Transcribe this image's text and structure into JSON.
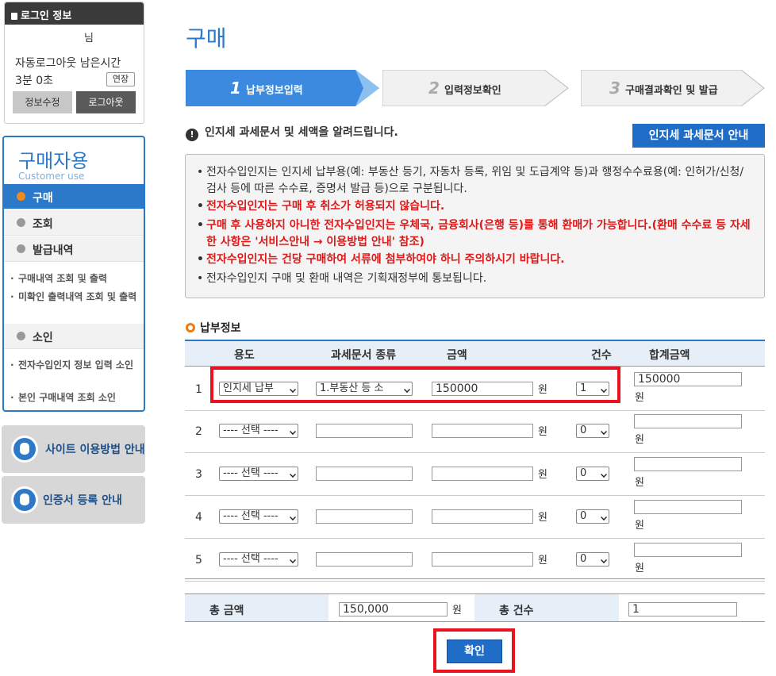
{
  "login": {
    "header": "로그인 정보",
    "user_suffix": "님",
    "auto_logout_label": "자동로그아웃 남은시간",
    "remaining_time": "3분 0초",
    "extend_label": "연장",
    "edit_info_label": "정보수정",
    "logout_label": "로그아웃"
  },
  "sidebar": {
    "title": "구매자용",
    "subtitle": "Customer use",
    "menu": {
      "purchase": "구매",
      "inquiry": "조회",
      "issue_history": "발급내역",
      "sub_history": "구매내역 조회 및 출력",
      "sub_unconfirmed": "미확인 출력내역 조회 및 출력",
      "lawsuit": "소인",
      "sub_stamp_info": "전자수입인지 정보 입력 소인",
      "sub_my_purchase": "본인 구매내역 조회 소인"
    },
    "site_guide": "사이트 이용방법 안내",
    "cert_guide": "인증서 등록 안내"
  },
  "page_title": "구매",
  "steps": [
    {
      "num": "1",
      "label": "납부정보입력",
      "active": true
    },
    {
      "num": "2",
      "label": "입력정보확인",
      "active": false
    },
    {
      "num": "3",
      "label": "구매결과확인 및 발급",
      "active": false
    }
  ],
  "notice": {
    "title": "인지세 과세문서 및 세액을 알려드립니다.",
    "guide_button": "인지세 과세문서 안내",
    "lines": [
      "전자수입인지는 인지세 납부용(예: 부동산 등기, 자동차 등록, 위임 및 도급계약 등)과 행정수수료용(예: 인허가/신청/검사 등에 따른 수수료, 증명서 발급 등)으로 구분됩니다.",
      "전자수입인지는 구매 후 취소가 허용되지 않습니다.",
      "구매 후 사용하지 아니한 전자수입인지는 우체국, 금융회사(은행 등)를 통해 환매가 가능합니다.(환매 수수료 등 자세한 사항은 '서비스안내 → 이용방법 안내' 참조)",
      "전자수입인지는 건당 구매하여 서류에 첨부하여야 하니 주의하시기 바랍니다.",
      "전자수입인지 구매 및 환매 내역은 기획재정부에 통보됩니다."
    ]
  },
  "payment": {
    "section_title": "납부정보",
    "columns": [
      "용도",
      "과세문서 종류",
      "금액",
      "건수",
      "합계금액"
    ],
    "won": "원",
    "rows": [
      {
        "idx": "1",
        "usage": "인지세 납부",
        "doc_type": "1.부동산 등 소",
        "amount": "150000",
        "count": "1",
        "total": "150000"
      },
      {
        "idx": "2",
        "usage": "---- 선택 ----",
        "doc_type": "",
        "amount": "",
        "count": "0",
        "total": ""
      },
      {
        "idx": "3",
        "usage": "---- 선택 ----",
        "doc_type": "",
        "amount": "",
        "count": "0",
        "total": ""
      },
      {
        "idx": "4",
        "usage": "---- 선택 ----",
        "doc_type": "",
        "amount": "",
        "count": "0",
        "total": ""
      },
      {
        "idx": "5",
        "usage": "---- 선택 ----",
        "doc_type": "",
        "amount": "",
        "count": "0",
        "total": ""
      }
    ]
  },
  "totals": {
    "amount_label": "총 금액",
    "amount_value": "150,000",
    "count_label": "총 건수",
    "count_value": "1"
  },
  "confirm_label": "확인",
  "colors": {
    "primary": "#2b79c8",
    "button": "#1f6dc6",
    "alert": "#e01818",
    "highlight": "#e8131f"
  }
}
